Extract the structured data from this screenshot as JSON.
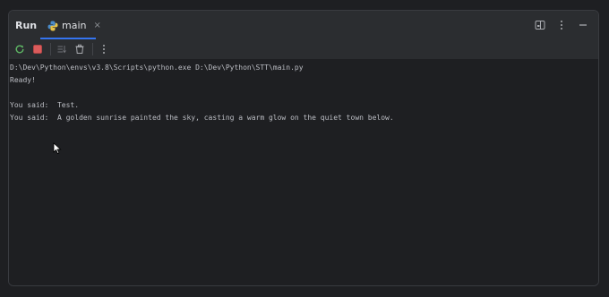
{
  "panel": {
    "title": "Run",
    "tab": {
      "label": "main",
      "close_glyph": "×",
      "icon": "python-icon"
    },
    "header_icons": [
      "layout-icon",
      "more-vertical-icon",
      "minimize-icon"
    ]
  },
  "toolbar": {
    "buttons": [
      "rerun-icon",
      "stop-icon",
      "scroll-to-end-icon",
      "clear-icon",
      "more-vertical-icon"
    ]
  },
  "console": {
    "lines": [
      "D:\\Dev\\Python\\envs\\v3.8\\Scripts\\python.exe D:\\Dev\\Python\\STT\\main.py",
      "Ready!",
      "",
      "You said:  Test.",
      "You said:  A golden sunrise painted the sky, casting a warm glow on the quiet town below."
    ]
  },
  "colors": {
    "background": "#1e1f22",
    "header_bg": "#2b2d30",
    "accent": "#3574f0",
    "stop_red": "#db5c5c",
    "rerun_green": "#5fb865",
    "text": "#bcbec4"
  }
}
